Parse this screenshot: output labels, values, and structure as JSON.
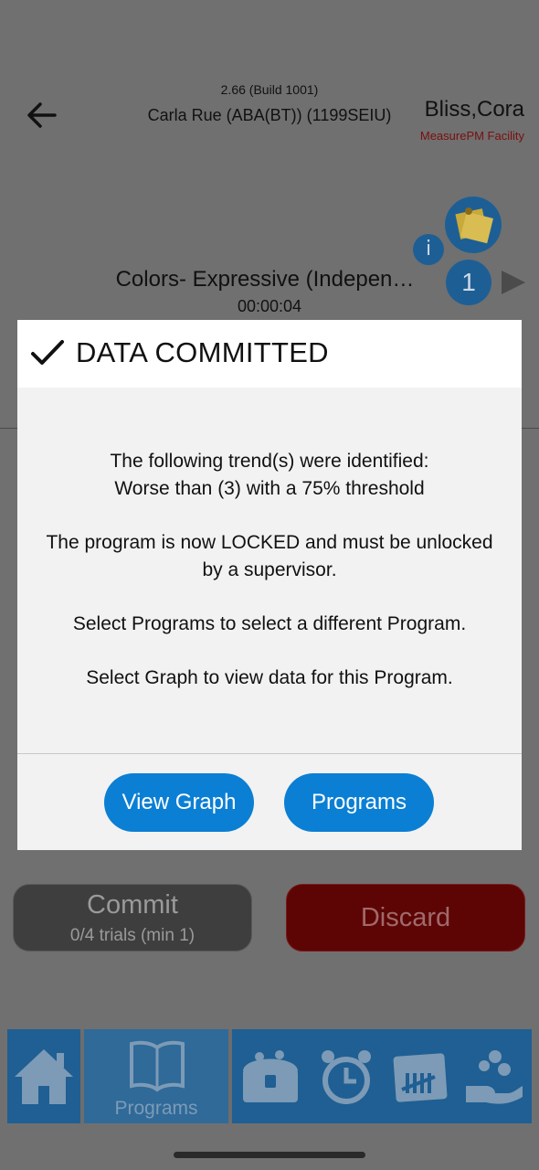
{
  "header": {
    "build": "2.66 (Build 1001)",
    "staff": "Carla Rue (ABA(BT)) (1199SEIU)",
    "client_name": "Bliss,Cora",
    "facility": "MeasurePM Facility",
    "info_label": "i",
    "trial_count": "1"
  },
  "program": {
    "title": "Colors- Expressive (Indepen…",
    "timer": "00:00:04"
  },
  "actions": {
    "commit_label": "Commit",
    "commit_sub": "0/4 trials (min 1)",
    "discard_label": "Discard"
  },
  "nav": {
    "programs_label": "Programs"
  },
  "dialog": {
    "title": "DATA COMMITTED",
    "line1": "The following trend(s) were identified:",
    "line2": "Worse than (3) with a 75% threshold",
    "line3": "The program is now LOCKED and must be unlocked by a supervisor.",
    "line4": "Select Programs to select a different Program.",
    "line5": "Select Graph to view data for this Program.",
    "view_graph_label": "View Graph",
    "programs_label": "Programs"
  },
  "colors": {
    "accent_blue": "#0b7fd4",
    "nav_blue": "#1f5f93",
    "discard_red": "#5d0505"
  }
}
